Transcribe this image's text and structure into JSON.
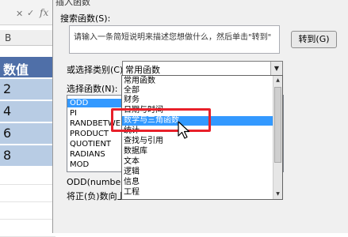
{
  "excel": {
    "fx_label": "fx",
    "column_label": "B",
    "header_cell": "数值",
    "cells": [
      "2",
      "4",
      "6",
      "8"
    ]
  },
  "dialog": {
    "title": "插入函数",
    "search_label": "搜索函数(S):",
    "search_placeholder": "请输入一条简短说明来描述您想做什么，然后单击\"转到\"",
    "goto_button": "转到(G)",
    "category_label": "或选择类别(C):",
    "category_value": "常用函数",
    "function_label": "选择函数(N):",
    "functions": [
      "ODD",
      "PI",
      "RANDBETWEEN",
      "PRODUCT",
      "QUOTIENT",
      "RADIANS",
      "MOD"
    ],
    "selected_function": "ODD",
    "description_syntax": "ODD(number)",
    "description_text": "将正(负)数向上"
  },
  "dropdown": {
    "items": [
      "常用函数",
      "全部",
      "财务",
      "日期与时间",
      "数学与三角函数",
      "统计",
      "查找与引用",
      "数据库",
      "文本",
      "逻辑",
      "信息",
      "工程"
    ],
    "highlighted": "数学与三角函数"
  },
  "colors": {
    "highlight": "#3399ff",
    "annotation_red": "#e8202a",
    "excel_header": "#4f6fa8",
    "excel_cell": "#b8cce4"
  }
}
